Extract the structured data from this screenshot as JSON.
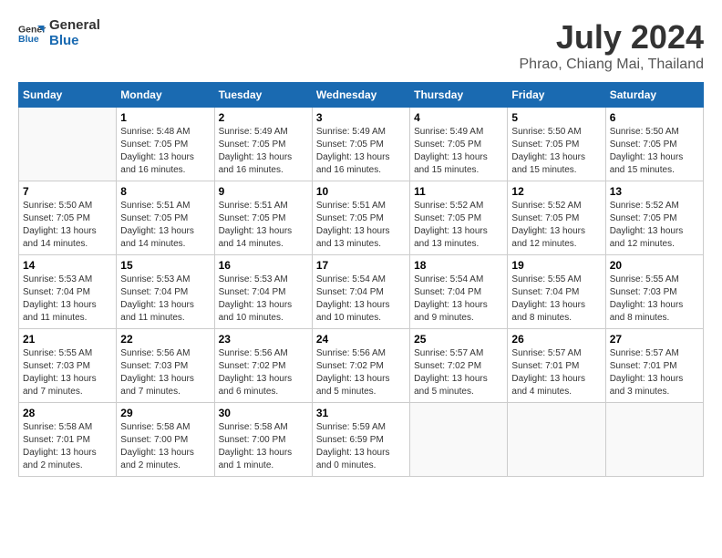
{
  "logo": {
    "line1": "General",
    "line2": "Blue"
  },
  "title": "July 2024",
  "location": "Phrao, Chiang Mai, Thailand",
  "days_of_week": [
    "Sunday",
    "Monday",
    "Tuesday",
    "Wednesday",
    "Thursday",
    "Friday",
    "Saturday"
  ],
  "weeks": [
    [
      {
        "day": "",
        "sunrise": "",
        "sunset": "",
        "daylight": ""
      },
      {
        "day": "1",
        "sunrise": "Sunrise: 5:48 AM",
        "sunset": "Sunset: 7:05 PM",
        "daylight": "Daylight: 13 hours and 16 minutes."
      },
      {
        "day": "2",
        "sunrise": "Sunrise: 5:49 AM",
        "sunset": "Sunset: 7:05 PM",
        "daylight": "Daylight: 13 hours and 16 minutes."
      },
      {
        "day": "3",
        "sunrise": "Sunrise: 5:49 AM",
        "sunset": "Sunset: 7:05 PM",
        "daylight": "Daylight: 13 hours and 16 minutes."
      },
      {
        "day": "4",
        "sunrise": "Sunrise: 5:49 AM",
        "sunset": "Sunset: 7:05 PM",
        "daylight": "Daylight: 13 hours and 15 minutes."
      },
      {
        "day": "5",
        "sunrise": "Sunrise: 5:50 AM",
        "sunset": "Sunset: 7:05 PM",
        "daylight": "Daylight: 13 hours and 15 minutes."
      },
      {
        "day": "6",
        "sunrise": "Sunrise: 5:50 AM",
        "sunset": "Sunset: 7:05 PM",
        "daylight": "Daylight: 13 hours and 15 minutes."
      }
    ],
    [
      {
        "day": "7",
        "sunrise": "Sunrise: 5:50 AM",
        "sunset": "Sunset: 7:05 PM",
        "daylight": "Daylight: 13 hours and 14 minutes."
      },
      {
        "day": "8",
        "sunrise": "Sunrise: 5:51 AM",
        "sunset": "Sunset: 7:05 PM",
        "daylight": "Daylight: 13 hours and 14 minutes."
      },
      {
        "day": "9",
        "sunrise": "Sunrise: 5:51 AM",
        "sunset": "Sunset: 7:05 PM",
        "daylight": "Daylight: 13 hours and 14 minutes."
      },
      {
        "day": "10",
        "sunrise": "Sunrise: 5:51 AM",
        "sunset": "Sunset: 7:05 PM",
        "daylight": "Daylight: 13 hours and 13 minutes."
      },
      {
        "day": "11",
        "sunrise": "Sunrise: 5:52 AM",
        "sunset": "Sunset: 7:05 PM",
        "daylight": "Daylight: 13 hours and 13 minutes."
      },
      {
        "day": "12",
        "sunrise": "Sunrise: 5:52 AM",
        "sunset": "Sunset: 7:05 PM",
        "daylight": "Daylight: 13 hours and 12 minutes."
      },
      {
        "day": "13",
        "sunrise": "Sunrise: 5:52 AM",
        "sunset": "Sunset: 7:05 PM",
        "daylight": "Daylight: 13 hours and 12 minutes."
      }
    ],
    [
      {
        "day": "14",
        "sunrise": "Sunrise: 5:53 AM",
        "sunset": "Sunset: 7:04 PM",
        "daylight": "Daylight: 13 hours and 11 minutes."
      },
      {
        "day": "15",
        "sunrise": "Sunrise: 5:53 AM",
        "sunset": "Sunset: 7:04 PM",
        "daylight": "Daylight: 13 hours and 11 minutes."
      },
      {
        "day": "16",
        "sunrise": "Sunrise: 5:53 AM",
        "sunset": "Sunset: 7:04 PM",
        "daylight": "Daylight: 13 hours and 10 minutes."
      },
      {
        "day": "17",
        "sunrise": "Sunrise: 5:54 AM",
        "sunset": "Sunset: 7:04 PM",
        "daylight": "Daylight: 13 hours and 10 minutes."
      },
      {
        "day": "18",
        "sunrise": "Sunrise: 5:54 AM",
        "sunset": "Sunset: 7:04 PM",
        "daylight": "Daylight: 13 hours and 9 minutes."
      },
      {
        "day": "19",
        "sunrise": "Sunrise: 5:55 AM",
        "sunset": "Sunset: 7:04 PM",
        "daylight": "Daylight: 13 hours and 8 minutes."
      },
      {
        "day": "20",
        "sunrise": "Sunrise: 5:55 AM",
        "sunset": "Sunset: 7:03 PM",
        "daylight": "Daylight: 13 hours and 8 minutes."
      }
    ],
    [
      {
        "day": "21",
        "sunrise": "Sunrise: 5:55 AM",
        "sunset": "Sunset: 7:03 PM",
        "daylight": "Daylight: 13 hours and 7 minutes."
      },
      {
        "day": "22",
        "sunrise": "Sunrise: 5:56 AM",
        "sunset": "Sunset: 7:03 PM",
        "daylight": "Daylight: 13 hours and 7 minutes."
      },
      {
        "day": "23",
        "sunrise": "Sunrise: 5:56 AM",
        "sunset": "Sunset: 7:02 PM",
        "daylight": "Daylight: 13 hours and 6 minutes."
      },
      {
        "day": "24",
        "sunrise": "Sunrise: 5:56 AM",
        "sunset": "Sunset: 7:02 PM",
        "daylight": "Daylight: 13 hours and 5 minutes."
      },
      {
        "day": "25",
        "sunrise": "Sunrise: 5:57 AM",
        "sunset": "Sunset: 7:02 PM",
        "daylight": "Daylight: 13 hours and 5 minutes."
      },
      {
        "day": "26",
        "sunrise": "Sunrise: 5:57 AM",
        "sunset": "Sunset: 7:01 PM",
        "daylight": "Daylight: 13 hours and 4 minutes."
      },
      {
        "day": "27",
        "sunrise": "Sunrise: 5:57 AM",
        "sunset": "Sunset: 7:01 PM",
        "daylight": "Daylight: 13 hours and 3 minutes."
      }
    ],
    [
      {
        "day": "28",
        "sunrise": "Sunrise: 5:58 AM",
        "sunset": "Sunset: 7:01 PM",
        "daylight": "Daylight: 13 hours and 2 minutes."
      },
      {
        "day": "29",
        "sunrise": "Sunrise: 5:58 AM",
        "sunset": "Sunset: 7:00 PM",
        "daylight": "Daylight: 13 hours and 2 minutes."
      },
      {
        "day": "30",
        "sunrise": "Sunrise: 5:58 AM",
        "sunset": "Sunset: 7:00 PM",
        "daylight": "Daylight: 13 hours and 1 minute."
      },
      {
        "day": "31",
        "sunrise": "Sunrise: 5:59 AM",
        "sunset": "Sunset: 6:59 PM",
        "daylight": "Daylight: 13 hours and 0 minutes."
      },
      {
        "day": "",
        "sunrise": "",
        "sunset": "",
        "daylight": ""
      },
      {
        "day": "",
        "sunrise": "",
        "sunset": "",
        "daylight": ""
      },
      {
        "day": "",
        "sunrise": "",
        "sunset": "",
        "daylight": ""
      }
    ]
  ]
}
